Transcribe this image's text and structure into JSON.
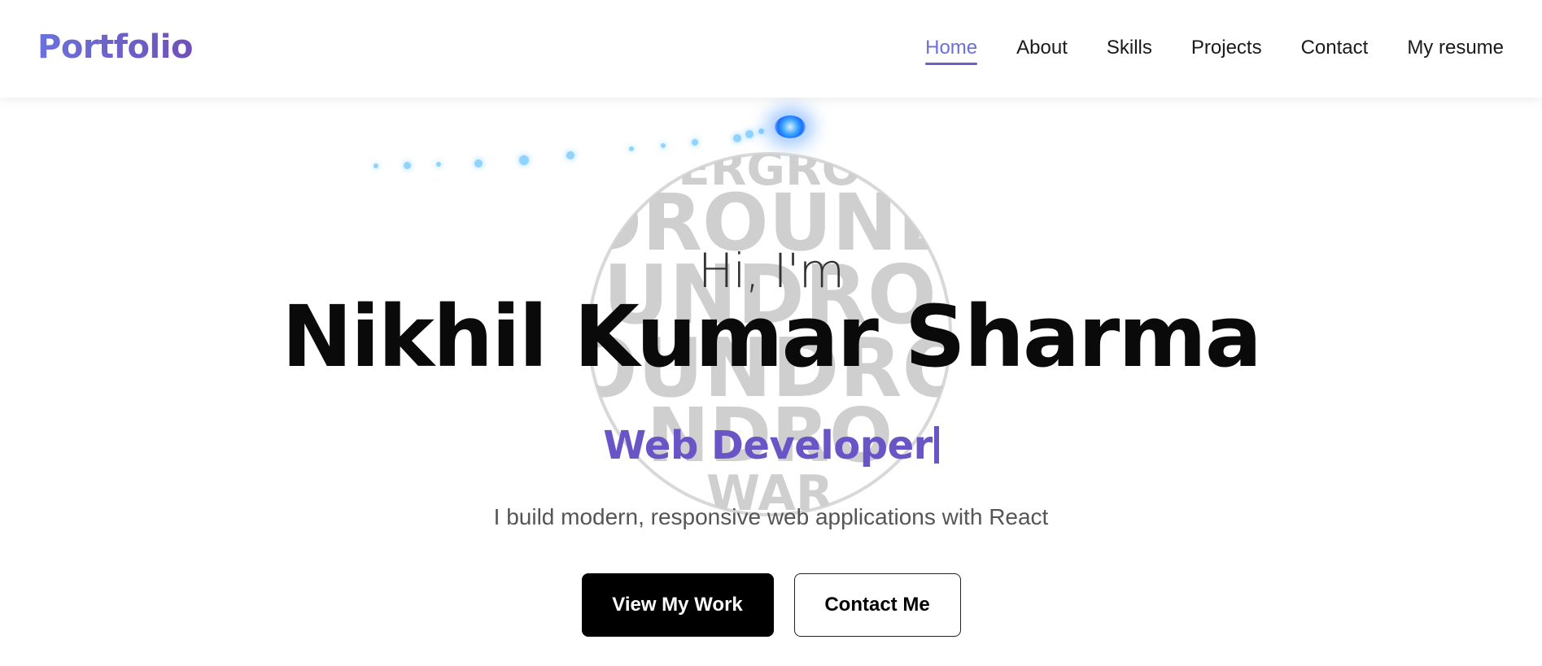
{
  "nav": {
    "brand": "Portfolio",
    "links": [
      {
        "label": "Home",
        "active": true
      },
      {
        "label": "About"
      },
      {
        "label": "Skills"
      },
      {
        "label": "Projects"
      },
      {
        "label": "Contact"
      },
      {
        "label": "My resume"
      }
    ]
  },
  "hero": {
    "greeting": "Hi, I'm",
    "name": {
      "first": "Nikhil",
      "middle": "Kumar",
      "last": "Sharma"
    },
    "role": "Web Developer",
    "tagline": "I build modern, responsive web applications with React",
    "buttons": {
      "primary": "View My Work",
      "secondary": "Contact Me"
    },
    "globe_text": [
      "UNDERGROUND",
      "DROUND",
      "UNDRO",
      "OUNDRO",
      "NDRO",
      "WAR"
    ]
  },
  "colors": {
    "brand_start": "#6a72dd",
    "brand_end": "#7150b8",
    "accent": "#6a55c7",
    "active_link": "#6c6fda",
    "highlight_red": "#ff7a7a",
    "highlight_blue": "#7074ee",
    "highlight_green": "#9bf29b"
  },
  "icons": {
    "comet": "comet-glow",
    "globe": "lettered-globe"
  }
}
